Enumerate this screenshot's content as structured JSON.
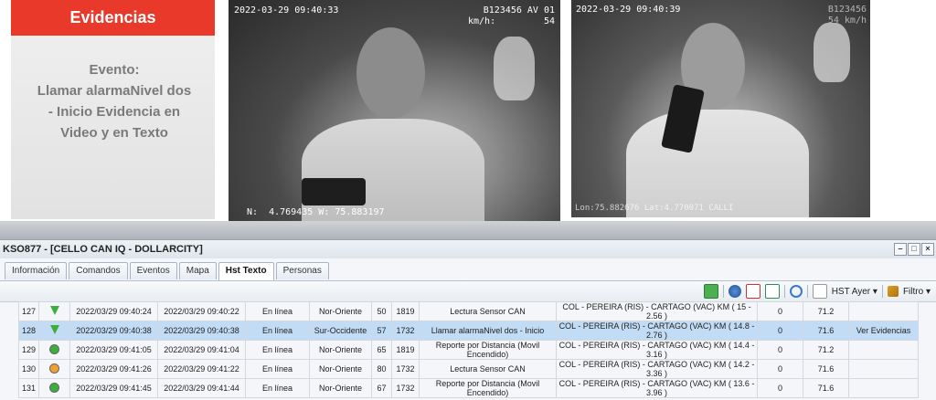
{
  "slide": {
    "header": "Evidencias",
    "event_text": "Evento:\nLlamar alarmaNivel dos - Inicio Evidencia en Video y en Texto",
    "cam1": {
      "timestamp": "2022-03-29 09:40:33",
      "unit": "B123456 AV 01",
      "speed_label": "km/h:",
      "speed": "54",
      "coords": "N:  4.769435 W: 75.883197"
    },
    "cam2": {
      "timestamp": "2022-03-29 09:40:39",
      "unit": "B123456",
      "speed": "54 km/h",
      "coords": "Lon:75.882676 Lat:4.770071 CALLI"
    }
  },
  "window": {
    "title": "KSO877 - [CELLO CAN IQ - DOLLARCITY]",
    "tabs": [
      "Información",
      "Comandos",
      "Eventos",
      "Mapa",
      "Hst Texto",
      "Personas"
    ],
    "active_tab": "Hst Texto",
    "toolbar": {
      "hst_label": "HST Ayer",
      "filter_label": "Filtro"
    }
  },
  "table": {
    "rows": [
      {
        "id": "127",
        "status": "arrow-green",
        "gps": "2022/03/29 09:40:24",
        "server": "2022/03/29 09:40:22",
        "online": "En línea",
        "dir": "Nor-Oriente",
        "speed": "50",
        "odo": "1819",
        "event": "Lectura Sensor CAN",
        "loc": "COL - PEREIRA (RIS) - CARTAGO (VAC) KM ( 15 - 2.56 )",
        "n": "0",
        "v": "71.2",
        "ev": ""
      },
      {
        "id": "128",
        "status": "arrow-green",
        "gps": "2022/03/29 09:40:38",
        "server": "2022/03/29 09:40:38",
        "online": "En línea",
        "dir": "Sur-Occidente",
        "speed": "57",
        "odo": "1732",
        "event": "Llamar alarmaNivel dos - Inicio",
        "loc": "COL - PEREIRA (RIS) - CARTAGO (VAC) KM ( 14.8 - 2.76 )",
        "n": "0",
        "v": "71.6",
        "ev": "Ver Evidencias"
      },
      {
        "id": "129",
        "status": "dot-green",
        "gps": "2022/03/29 09:41:05",
        "server": "2022/03/29 09:41:04",
        "online": "En línea",
        "dir": "Nor-Oriente",
        "speed": "65",
        "odo": "1819",
        "event": "Reporte por Distancia (Movil Encendido)",
        "loc": "COL - PEREIRA (RIS) - CARTAGO (VAC) KM ( 14.4 - 3.16 )",
        "n": "0",
        "v": "71.2",
        "ev": ""
      },
      {
        "id": "130",
        "status": "dot-orange",
        "gps": "2022/03/29 09:41:26",
        "server": "2022/03/29 09:41:22",
        "online": "En línea",
        "dir": "Nor-Oriente",
        "speed": "80",
        "odo": "1732",
        "event": "Lectura Sensor CAN",
        "loc": "COL - PEREIRA (RIS) - CARTAGO (VAC) KM ( 14.2 - 3.36 )",
        "n": "0",
        "v": "71.6",
        "ev": ""
      },
      {
        "id": "131",
        "status": "dot-green",
        "gps": "2022/03/29 09:41:45",
        "server": "2022/03/29 09:41:44",
        "online": "En línea",
        "dir": "Nor-Oriente",
        "speed": "67",
        "odo": "1732",
        "event": "Reporte por Distancia (Movil Encendido)",
        "loc": "COL - PEREIRA (RIS) - CARTAGO (VAC) KM ( 13.6 - 3.96 )",
        "n": "0",
        "v": "71.6",
        "ev": ""
      }
    ]
  },
  "colors": {
    "accent": "#e8392a",
    "selected": "#c2dcf5",
    "green": "#3cae3c",
    "orange": "#f0a030"
  }
}
